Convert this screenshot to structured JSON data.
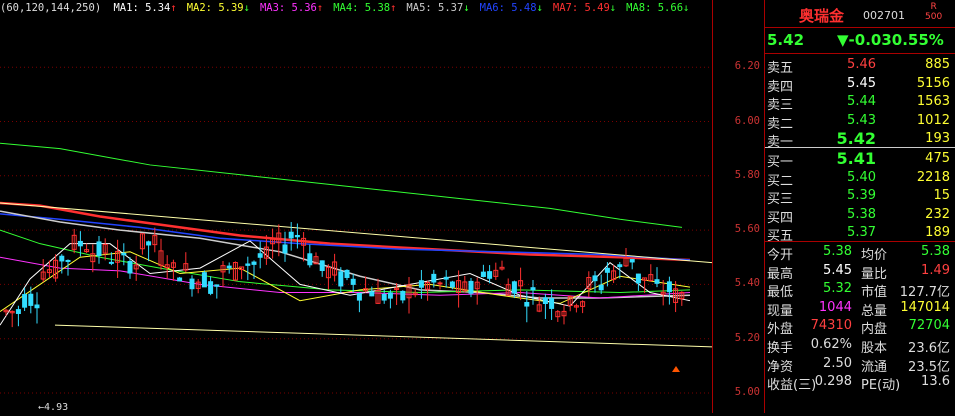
{
  "ma_bar": {
    "prefix": "(60,120,144,250)",
    "items": [
      {
        "label": "MA1: 5.34",
        "arrow": "↑",
        "color": "#ffffff",
        "arrow_color": "#ff3030"
      },
      {
        "label": "MA2: 5.39",
        "arrow": "↓",
        "color": "#ffff33",
        "arrow_color": "#33ff33"
      },
      {
        "label": "MA3: 5.36",
        "arrow": "↑",
        "color": "#ff33ff",
        "arrow_color": "#ff3030"
      },
      {
        "label": "MA4: 5.38",
        "arrow": "↑",
        "color": "#33ff33",
        "arrow_color": "#ff3030"
      },
      {
        "label": "MA5: 5.37",
        "arrow": "↓",
        "color": "#cccccc",
        "arrow_color": "#33ff33"
      },
      {
        "label": "MA6: 5.48",
        "arrow": "↓",
        "color": "#2244ff",
        "arrow_color": "#33ff33"
      },
      {
        "label": "MA7: 5.49",
        "arrow": "↓",
        "color": "#ff3030",
        "arrow_color": "#33ff33"
      },
      {
        "label": "MA8: 5.66",
        "arrow": "↓",
        "color": "#33ff33",
        "arrow_color": "#33ff33"
      }
    ]
  },
  "price_axis": {
    "ticks": [
      "6.20",
      "6.00",
      "5.80",
      "5.60",
      "5.40",
      "5.20",
      "5.00"
    ]
  },
  "chart": {
    "low_label": "4.93",
    "up_color": "#ff3030",
    "down_color": "#33ddff"
  },
  "quote": {
    "name": "奥瑞金",
    "code": "002701",
    "flag_top": "R",
    "flag_bottom": "500",
    "price": "5.42",
    "change": "▼-0.03",
    "change_pct": "0.55%",
    "asks": [
      {
        "label": "卖五",
        "price": "5.46",
        "vol": "885",
        "color": "#ff4040"
      },
      {
        "label": "卖四",
        "price": "5.45",
        "vol": "5156",
        "color": "#ffffff"
      },
      {
        "label": "卖三",
        "price": "5.44",
        "vol": "1563",
        "color": "#33ff33"
      },
      {
        "label": "卖二",
        "price": "5.43",
        "vol": "1012",
        "color": "#33ff33"
      },
      {
        "label": "卖一",
        "price": "5.42",
        "vol": "193",
        "color": "#33ff33"
      }
    ],
    "bids": [
      {
        "label": "买一",
        "price": "5.41",
        "vol": "475",
        "color": "#33ff33"
      },
      {
        "label": "买二",
        "price": "5.40",
        "vol": "2218",
        "color": "#33ff33"
      },
      {
        "label": "买三",
        "price": "5.39",
        "vol": "15",
        "color": "#33ff33"
      },
      {
        "label": "买四",
        "price": "5.38",
        "vol": "232",
        "color": "#33ff33"
      },
      {
        "label": "买五",
        "price": "5.37",
        "vol": "189",
        "color": "#33ff33"
      }
    ],
    "stats": [
      {
        "l1": "今开",
        "v1": "5.38",
        "c1": "#33ff33",
        "l2": "均价",
        "v2": "5.38",
        "c2": "#33ff33"
      },
      {
        "l1": "最高",
        "v1": "5.45",
        "c1": "#ffffff",
        "l2": "量比",
        "v2": "1.49",
        "c2": "#ff4040"
      },
      {
        "l1": "最低",
        "v1": "5.32",
        "c1": "#33ff33",
        "l2": "市值",
        "v2": "127.7亿",
        "c2": "#dddddd"
      },
      {
        "l1": "现量",
        "v1": "1044",
        "c1": "#ff33ff",
        "l2": "总量",
        "v2": "147014",
        "c2": "#ffff33"
      },
      {
        "l1": "外盘",
        "v1": "74310",
        "c1": "#ff4040",
        "l2": "内盘",
        "v2": "72704",
        "c2": "#33ff33"
      },
      {
        "l1": "换手",
        "v1": "0.62%",
        "c1": "#dddddd",
        "l2": "股本",
        "v2": "23.6亿",
        "c2": "#dddddd"
      },
      {
        "l1": "净资",
        "v1": "2.50",
        "c1": "#dddddd",
        "l2": "流通",
        "v2": "23.5亿",
        "c2": "#dddddd"
      },
      {
        "l1": "收益(三)",
        "v1": "0.298",
        "c1": "#dddddd",
        "l2": "PE(动)",
        "v2": "13.6",
        "c2": "#dddddd"
      }
    ]
  }
}
